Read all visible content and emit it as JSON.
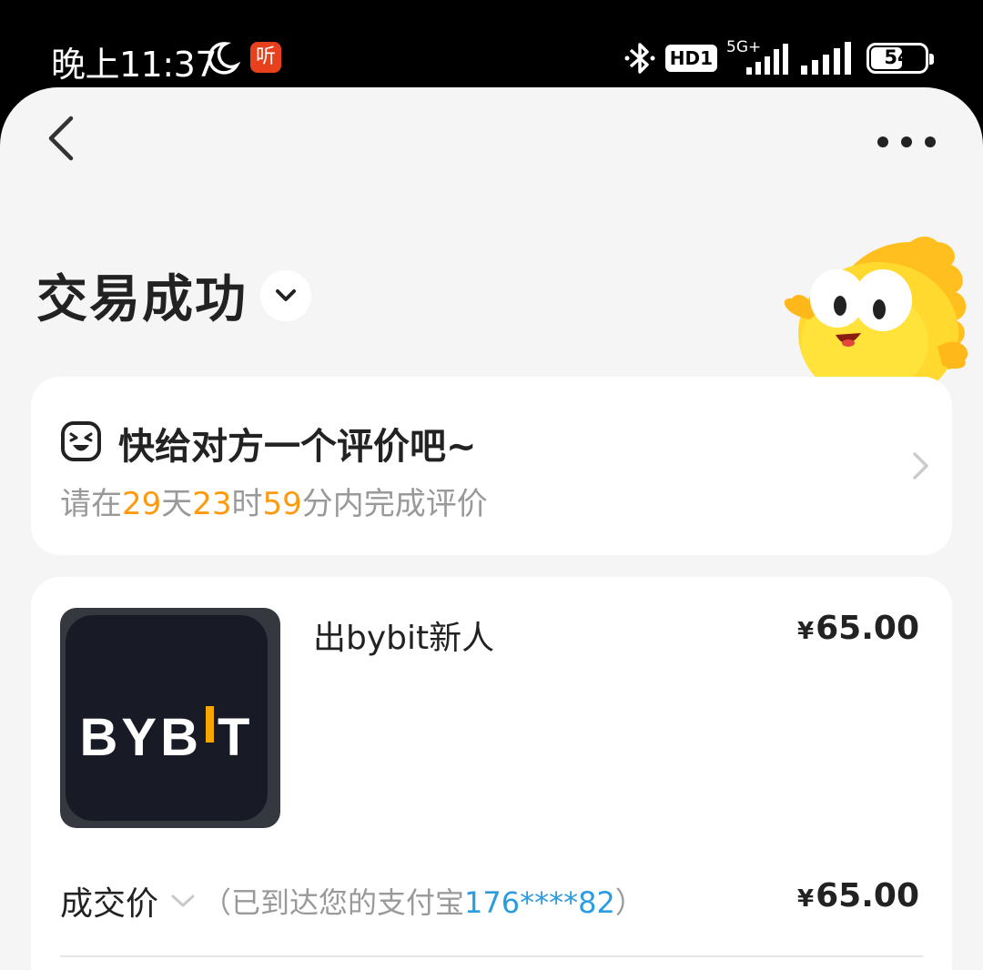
{
  "status_bar": {
    "time": "晚上11:37",
    "ting_badge": "听",
    "hd_label": "HD1",
    "network_label": "5G+",
    "battery": "54"
  },
  "header": {
    "title": "交易成功"
  },
  "review": {
    "title": "快给对方一个评价吧~",
    "prefix": "请在",
    "days": "29",
    "days_unit": "天",
    "hours": "23",
    "hours_unit": "时",
    "minutes": "59",
    "suffix": "分内完成评价"
  },
  "item": {
    "thumb_text_left": "BYB",
    "thumb_text_right": "T",
    "title": "出bybit新人",
    "currency": "¥",
    "price": "65.00"
  },
  "deal": {
    "label": "成交价",
    "note_prefix": "（已到达您的支付宝",
    "account": "176****82",
    "note_suffix": "）",
    "currency": "¥",
    "price": "65.00"
  }
}
